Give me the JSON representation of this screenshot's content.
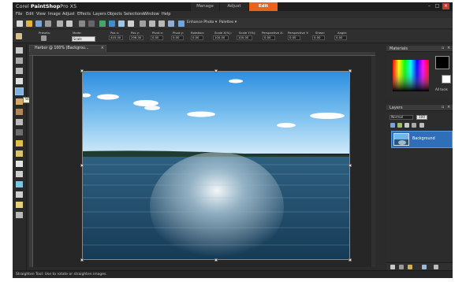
{
  "app": {
    "title_prefix": "Corel ",
    "title_brand": "PaintShop",
    "title_suffix": "Pro X5"
  },
  "workspace_tabs": [
    "Manage",
    "Adjust",
    "Edit"
  ],
  "active_workspace": "Edit",
  "menu": [
    "File",
    "Edit",
    "View",
    "Image",
    "Adjust",
    "Effects",
    "Layers",
    "Objects",
    "Selections",
    "Window",
    "Help"
  ],
  "toolbar": {
    "enhance_photo": "Enhance Photo ▾",
    "palettes": "Palettes ▾"
  },
  "tool_options": {
    "presets_label": "Presets:",
    "mode_label": "Mode:",
    "mode_value": "Scale",
    "fields": [
      {
        "label": "Pos x:",
        "value": "445.00"
      },
      {
        "label": "Pos y:",
        "value": "296.00"
      },
      {
        "label": "Pivot x:",
        "value": "0.00"
      },
      {
        "label": "Pivot y:",
        "value": "0.00"
      },
      {
        "label": "Rotation:",
        "value": "0.00"
      },
      {
        "label": "Scale X(%):",
        "value": "100.00"
      },
      {
        "label": "Scale Y(%):",
        "value": "100.00"
      },
      {
        "label": "Perspective X:",
        "value": "0.00"
      },
      {
        "label": "Perspective Y:",
        "value": "0.00"
      },
      {
        "label": "Shear:",
        "value": "0.00"
      },
      {
        "label": "Angle:",
        "value": "0.00"
      }
    ]
  },
  "tooltip": "Straighten Tool",
  "document": {
    "tab_label": "Harbor @ 100% (Backgrou...",
    "close": "×"
  },
  "status_text": "Straighten Tool: Use to rotate or straighten images.",
  "panels": {
    "materials": {
      "title": "Materials",
      "all_tools": "All tools"
    },
    "layers": {
      "title": "Layers",
      "blend_mode": "Normal",
      "opacity": "100",
      "layer_name": "Background"
    }
  },
  "colors": {
    "accent": "#e8631c",
    "panel_bg": "#2b2b2b",
    "layer_selected": "#2f6fb9"
  }
}
